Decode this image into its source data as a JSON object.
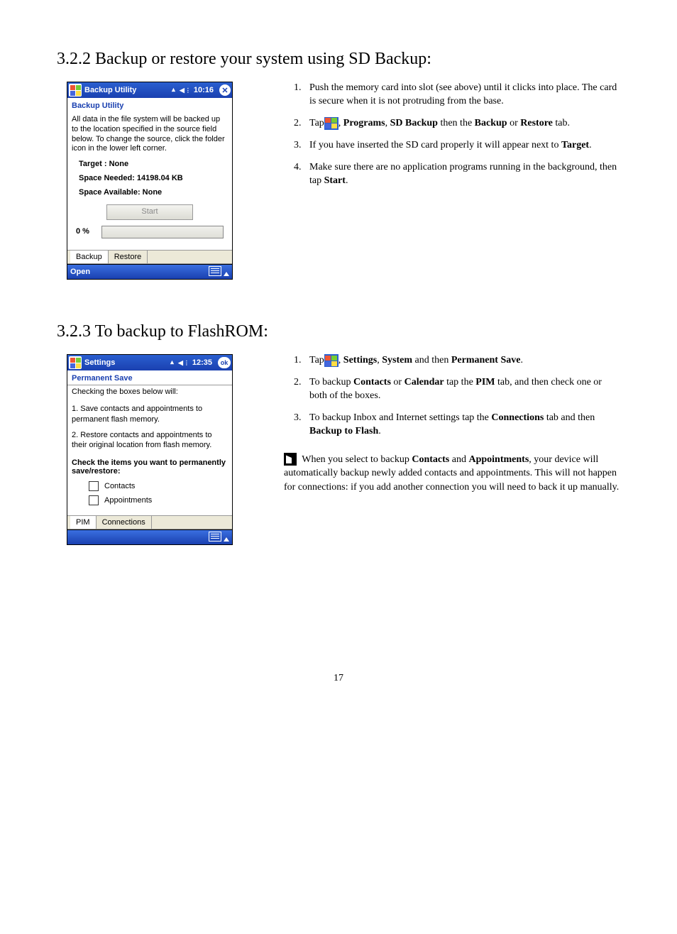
{
  "section1": {
    "heading": "3.2.2 Backup or restore your system using SD Backup:",
    "screenshot": {
      "titlebar": "Backup Utility",
      "time": "10:16",
      "subhead": "Backup Utility",
      "desc": "All data in the file system will be backed up to the location specified in the source field below. To change the source, click the folder icon in the lower left corner.",
      "target": "Target : None",
      "space_needed": "Space Needed: 14198.04 KB",
      "space_available": "Space Available: None",
      "start_btn": "Start",
      "progress": "0 %",
      "tab_backup": "Backup",
      "tab_restore": "Restore",
      "bottom_cmd": "Open"
    },
    "steps": {
      "s1": "Push the memory card into slot (see above) until it clicks into place. The card is secure when it is not protruding from the base.",
      "s2a": "Tap",
      "s2_programs": "Programs",
      "s2_sd": "SD Backup",
      "s2_then": " then the ",
      "s2_backup": "Backup",
      "s2_or": " or ",
      "s2_restore": "Restore",
      "s2_tab": " tab.",
      "s3a": "If you have inserted the SD card properly it will appear next to ",
      "s3_target": "Target",
      "s3b": ".",
      "s4a": "Make sure there are no application programs running in the background, then tap ",
      "s4_start": "Start",
      "s4b": "."
    }
  },
  "section2": {
    "heading": "3.2.3 To backup to FlashROM:",
    "screenshot": {
      "titlebar": "Settings",
      "time": "12:35",
      "subhead": "Permanent Save",
      "intro": "Checking the boxes below will:",
      "item1": "1. Save contacts and appointments to permanent flash memory.",
      "item2": "2. Restore contacts and appointments to their original location from flash memory.",
      "check_help": "Check the items you want to permanently save/restore:",
      "chk_contacts": "Contacts",
      "chk_appts": "Appointments",
      "tab_pim": "PIM",
      "tab_conn": "Connections"
    },
    "steps": {
      "s1a": "Tap",
      "s1_settings": "Settings",
      "s1_system": "System",
      "s1_then": " and then ",
      "s1_ps": "Permanent Save",
      "s1b": ".",
      "s2a": "To backup ",
      "s2_contacts": "Contacts",
      "s2_or": " or ",
      "s2_cal": "Calendar",
      "s2b": " tap the ",
      "s2_pim": "PIM",
      "s2c": " tab, and then check one or both of the boxes.",
      "s3a": "To backup Inbox and Internet settings tap the ",
      "s3_conn": "Connections",
      "s3b": " tab and then ",
      "s3_btf": "Backup to Flash",
      "s3c": "."
    },
    "note": {
      "a": " When you select to backup ",
      "contacts": "Contacts",
      "and": " and ",
      "appts": "Appointments",
      "b": ", your device will automatically backup newly added contacts and appointments. This will not happen for connections: if you add another connection you will need to back it up manually."
    }
  },
  "page_number": "17"
}
